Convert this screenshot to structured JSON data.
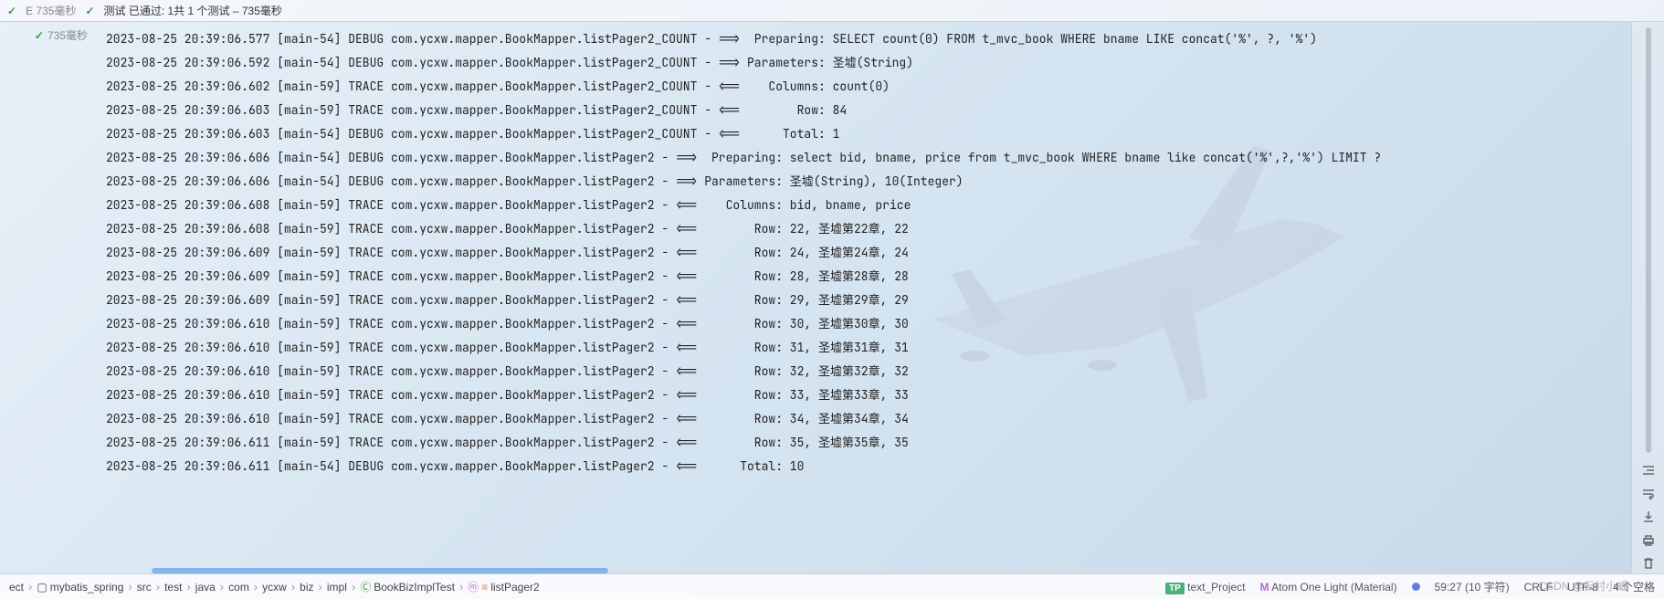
{
  "testHeader": {
    "leftCheck": "✓",
    "leftLabel": "E 735毫秒",
    "rightCheck": "✓",
    "rightLabel": "测试 已通过: 1共 1 个测试 – 735毫秒"
  },
  "leftGutter": {
    "check": "✓",
    "label": "735毫秒"
  },
  "consoleLines": [
    "2023-08-25 20:39:06.577 [main-54] DEBUG com.ycxw.mapper.BookMapper.listPager2_COUNT - ==>  Preparing: SELECT count(0) FROM t_mvc_book WHERE bname LIKE concat('%', ?, '%')",
    "2023-08-25 20:39:06.592 [main-54] DEBUG com.ycxw.mapper.BookMapper.listPager2_COUNT - ==> Parameters: 圣墟(String)",
    "2023-08-25 20:39:06.602 [main-59] TRACE com.ycxw.mapper.BookMapper.listPager2_COUNT - <==    Columns: count(0)",
    "2023-08-25 20:39:06.603 [main-59] TRACE com.ycxw.mapper.BookMapper.listPager2_COUNT - <==        Row: 84",
    "2023-08-25 20:39:06.603 [main-54] DEBUG com.ycxw.mapper.BookMapper.listPager2_COUNT - <==      Total: 1",
    "2023-08-25 20:39:06.606 [main-54] DEBUG com.ycxw.mapper.BookMapper.listPager2 - ==>  Preparing: select bid, bname, price from t_mvc_book WHERE bname like concat('%',?,'%') LIMIT ?",
    "2023-08-25 20:39:06.606 [main-54] DEBUG com.ycxw.mapper.BookMapper.listPager2 - ==> Parameters: 圣墟(String), 10(Integer)",
    "2023-08-25 20:39:06.608 [main-59] TRACE com.ycxw.mapper.BookMapper.listPager2 - <==    Columns: bid, bname, price",
    "2023-08-25 20:39:06.608 [main-59] TRACE com.ycxw.mapper.BookMapper.listPager2 - <==        Row: 22, 圣墟第22章, 22",
    "2023-08-25 20:39:06.609 [main-59] TRACE com.ycxw.mapper.BookMapper.listPager2 - <==        Row: 24, 圣墟第24章, 24",
    "2023-08-25 20:39:06.609 [main-59] TRACE com.ycxw.mapper.BookMapper.listPager2 - <==        Row: 28, 圣墟第28章, 28",
    "2023-08-25 20:39:06.609 [main-59] TRACE com.ycxw.mapper.BookMapper.listPager2 - <==        Row: 29, 圣墟第29章, 29",
    "2023-08-25 20:39:06.610 [main-59] TRACE com.ycxw.mapper.BookMapper.listPager2 - <==        Row: 30, 圣墟第30章, 30",
    "2023-08-25 20:39:06.610 [main-59] TRACE com.ycxw.mapper.BookMapper.listPager2 - <==        Row: 31, 圣墟第31章, 31",
    "2023-08-25 20:39:06.610 [main-59] TRACE com.ycxw.mapper.BookMapper.listPager2 - <==        Row: 32, 圣墟第32章, 32",
    "2023-08-25 20:39:06.610 [main-59] TRACE com.ycxw.mapper.BookMapper.listPager2 - <==        Row: 33, 圣墟第33章, 33",
    "2023-08-25 20:39:06.610 [main-59] TRACE com.ycxw.mapper.BookMapper.listPager2 - <==        Row: 34, 圣墟第34章, 34",
    "2023-08-25 20:39:06.611 [main-59] TRACE com.ycxw.mapper.BookMapper.listPager2 - <==        Row: 35, 圣墟第35章, 35",
    "2023-08-25 20:39:06.611 [main-54] DEBUG com.ycxw.mapper.BookMapper.listPager2 - <==      Total: 10"
  ],
  "breadcrumbs": {
    "items": [
      "ect",
      "mybatis_spring",
      "src",
      "test",
      "java",
      "com",
      "ycxw",
      "biz",
      "impl"
    ],
    "cls": "BookBizImplTest",
    "method": "listPager2"
  },
  "status": {
    "tpBadge": "TP",
    "tpLabel": "text_Project",
    "themeIcon": "M",
    "themeLabel": "Atom One Light (Material)",
    "cursor": "59:27 (10 字符)",
    "lineSep": "CRLF",
    "encoding": "UTF-8",
    "indent": "4 个空格"
  },
  "watermark": "CSDN @云村小威"
}
